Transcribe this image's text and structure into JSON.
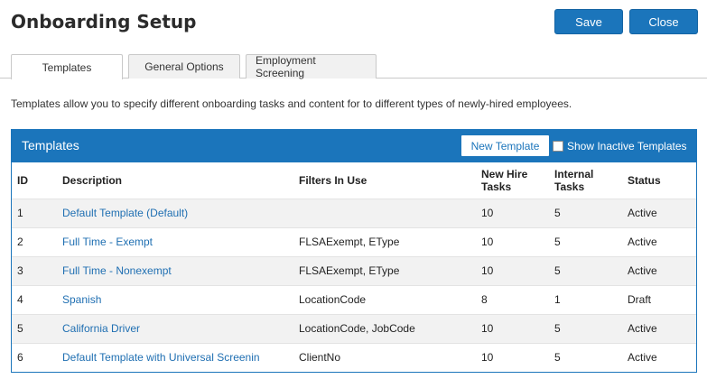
{
  "page": {
    "title": "Onboarding Setup",
    "save_label": "Save",
    "close_label": "Close"
  },
  "tabs": [
    {
      "label": "Templates",
      "active": true
    },
    {
      "label": "General Options",
      "active": false
    },
    {
      "label": "Employment Screening",
      "active": false
    }
  ],
  "intro_text": "Templates allow you to specify different onboarding tasks and content for to different types of newly-hired employees.",
  "panel": {
    "title": "Templates",
    "new_template_label": "New Template",
    "show_inactive_label": "Show Inactive Templates",
    "show_inactive_checked": false
  },
  "table": {
    "headers": {
      "id": "ID",
      "description": "Description",
      "filters": "Filters In Use",
      "new_hire_line1": "New Hire",
      "new_hire_line2": "Tasks",
      "internal_line1": "Internal",
      "internal_line2": "Tasks",
      "status": "Status"
    },
    "rows": [
      {
        "id": "1",
        "description": "Default Template (Default)",
        "filters": "",
        "new_hire": "10",
        "internal": "5",
        "status": "Active"
      },
      {
        "id": "2",
        "description": "Full Time - Exempt",
        "filters": "FLSAExempt, EType",
        "new_hire": "10",
        "internal": "5",
        "status": "Active"
      },
      {
        "id": "3",
        "description": "Full Time - Nonexempt",
        "filters": "FLSAExempt, EType",
        "new_hire": "10",
        "internal": "5",
        "status": "Active"
      },
      {
        "id": "4",
        "description": "Spanish",
        "filters": "LocationCode",
        "new_hire": "8",
        "internal": "1",
        "status": "Draft"
      },
      {
        "id": "5",
        "description": "California Driver",
        "filters": "LocationCode, JobCode",
        "new_hire": "10",
        "internal": "5",
        "status": "Active"
      },
      {
        "id": "6",
        "description": "Default Template with Universal Screenin",
        "filters": "ClientNo",
        "new_hire": "10",
        "internal": "5",
        "status": "Active"
      }
    ]
  },
  "colors": {
    "accent": "#1b75bb",
    "link": "#1f6fb2"
  }
}
